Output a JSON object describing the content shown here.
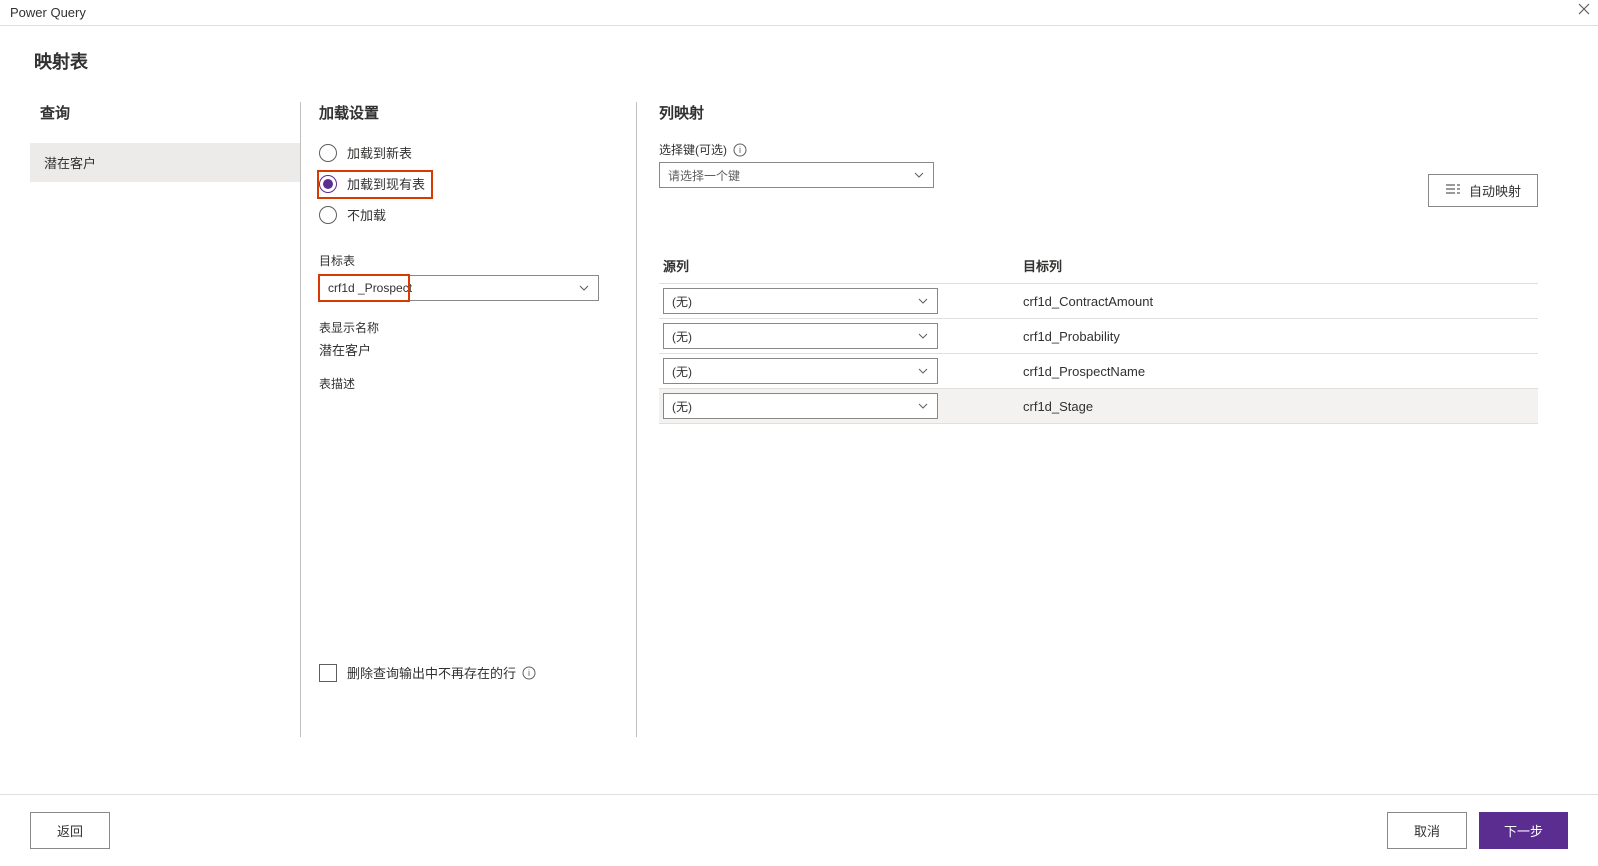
{
  "window": {
    "title": "Power Query"
  },
  "page": {
    "title": "映射表"
  },
  "queries": {
    "heading": "查询",
    "items": [
      "潜在客户"
    ]
  },
  "load": {
    "heading": "加载设置",
    "options": {
      "new": "加载到新表",
      "existing": "加载到现有表",
      "none": "不加载"
    },
    "targetTableLabel": "目标表",
    "targetTableValue": "crf1d _Prospect",
    "displayNameLabel": "表显示名称",
    "displayNameValue": "潜在客户",
    "descLabel": "表描述",
    "deleteRowsLabel": "删除查询输出中不再存在的行"
  },
  "map": {
    "heading": "列映射",
    "selectKeyLabel": "选择键(可选)",
    "selectKeyPlaceholder": "请选择一个键",
    "autoMap": "自动映射",
    "col1": "源列",
    "col2": "目标列",
    "noneLabel": "(无)",
    "rows": [
      {
        "target": "crf1d_ContractAmount"
      },
      {
        "target": "crf1d_Probability"
      },
      {
        "target": "crf1d_ProspectName"
      },
      {
        "target": "crf1d_Stage"
      }
    ]
  },
  "footer": {
    "back": "返回",
    "cancel": "取消",
    "next": "下一步"
  }
}
